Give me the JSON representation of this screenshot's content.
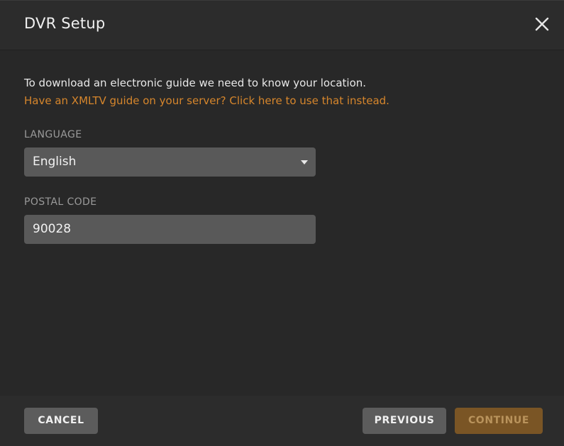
{
  "dialog": {
    "title": "DVR Setup",
    "close_icon": "close-icon"
  },
  "body": {
    "intro_text": "To download an electronic guide we need to know your location.",
    "xmltv_link": "Have an XMLTV guide on your server? Click here to use that instead.",
    "language": {
      "label": "LANGUAGE",
      "selected": "English",
      "icon": "chevron-down-icon"
    },
    "postal_code": {
      "label": "POSTAL CODE",
      "value": "90028"
    }
  },
  "footer": {
    "cancel_label": "CANCEL",
    "previous_label": "PREVIOUS",
    "continue_label": "CONTINUE",
    "continue_state": "disabled"
  },
  "colors": {
    "accent": "#d6862c",
    "background": "#282828",
    "header": "#2c2c2c",
    "field": "#595959",
    "continue_button": "#7a5525"
  }
}
